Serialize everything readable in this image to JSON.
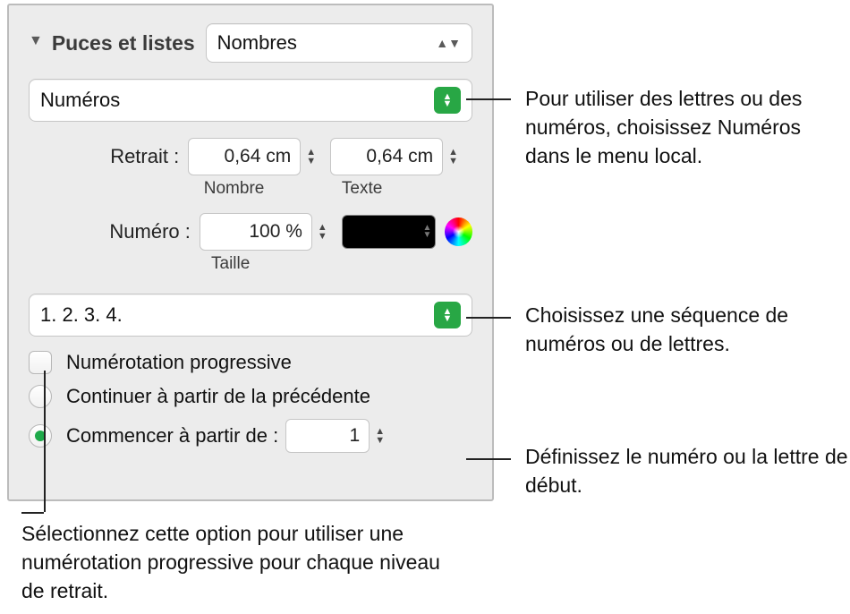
{
  "panel": {
    "section_title": "Puces et listes",
    "type_select": "Nombres",
    "style_select": "Numéros",
    "retrait": {
      "label": "Retrait :",
      "number_value": "0,64 cm",
      "number_sub": "Nombre",
      "text_value": "0,64 cm",
      "text_sub": "Texte"
    },
    "numero": {
      "label": "Numéro :",
      "size_value": "100 %",
      "size_sub": "Taille"
    },
    "sequence_select": "1. 2. 3. 4.",
    "progressive_label": "Numérotation progressive",
    "continue_label": "Continuer à partir de la précédente",
    "start_label": "Commencer à partir de :",
    "start_value": "1"
  },
  "callouts": {
    "numbers": "Pour utiliser des lettres ou des numéros, choisissez Numéros dans le menu local.",
    "sequence": "Choisissez une séquence de numéros ou de lettres.",
    "start": "Définissez le numéro ou la lettre de début.",
    "progressive": "Sélectionnez cette option pour utiliser une numérotation progressive pour chaque niveau de retrait."
  }
}
